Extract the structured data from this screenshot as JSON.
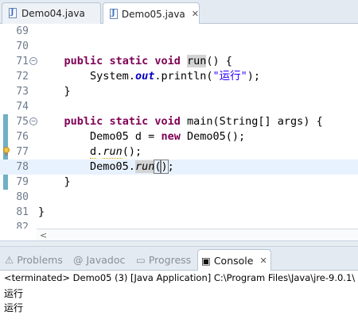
{
  "editor_tabs": [
    {
      "label": "Demo04.java",
      "icon": "java-file-icon"
    },
    {
      "label": "Demo05.java",
      "icon": "java-file-icon",
      "active": true,
      "close": "✕"
    }
  ],
  "lines": [
    {
      "num": "69"
    },
    {
      "num": "70"
    },
    {
      "num": "71",
      "fold": "−"
    },
    {
      "num": "72"
    },
    {
      "num": "73"
    },
    {
      "num": "74"
    },
    {
      "num": "75",
      "fold": "−"
    },
    {
      "num": "76"
    },
    {
      "num": "77"
    },
    {
      "num": "78"
    },
    {
      "num": "79"
    },
    {
      "num": "80"
    },
    {
      "num": "81"
    },
    {
      "num": "82"
    }
  ],
  "code": {
    "l71": {
      "indent": "    ",
      "kw1": "public",
      "kw2": "static",
      "kw3": "void",
      "name": "run",
      "rest": "() {"
    },
    "l72": {
      "indent": "        ",
      "cls": "System.",
      "field": "out",
      "call": ".println(",
      "str": "\"运行\"",
      "end": ");"
    },
    "l73": {
      "text": "    }"
    },
    "l75": {
      "indent": "    ",
      "kw1": "public",
      "kw2": "static",
      "kw3": "void",
      "rest": "main(String[] args) {"
    },
    "l76": {
      "indent": "        ",
      "pre": "Demo05 d = ",
      "kw": "new",
      "post": "Demo05();"
    },
    "l77": {
      "indent": "        ",
      "obj": "d",
      "dot": ".",
      "m": "run",
      "end": "();"
    },
    "l78": {
      "indent": "        ",
      "pre": "Demo05.",
      "m": "run",
      "open": "(",
      "close": ")",
      "end": ";"
    },
    "l79": {
      "text": "    }"
    },
    "l81": {
      "text": "}"
    }
  },
  "scroll_arrow": "<",
  "views": [
    {
      "label": "Problems",
      "icon": "problems-icon",
      "glyph": "⚠"
    },
    {
      "label": "Javadoc",
      "icon": "javadoc-icon",
      "glyph": "@"
    },
    {
      "label": "Progress",
      "icon": "progress-icon",
      "glyph": "▭"
    },
    {
      "label": "Console",
      "icon": "console-icon",
      "glyph": "▣",
      "active": true,
      "close": "✕"
    }
  ],
  "console": {
    "status": "<terminated> Demo05 (3) [Java Application] C:\\Program Files\\Java\\jre-9.0.1\\",
    "output": [
      "运行",
      "运行"
    ]
  },
  "colors": {
    "keyword": "#7f0055",
    "field": "#0000c0",
    "string": "#2a00ff",
    "current_line": "#e8f2fe",
    "change_bar": "#6fb0c4"
  }
}
